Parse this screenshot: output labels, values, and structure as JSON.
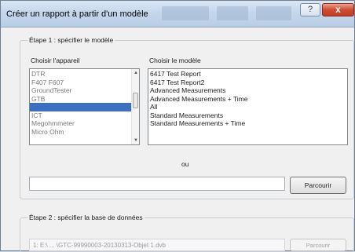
{
  "window": {
    "title": "Créer un rapport à partir d'un modèle",
    "help_label": "?",
    "close_label": "x"
  },
  "step1": {
    "legend": "Étape 1 : spécifier le modèle",
    "device_label": "Choisir l'appareil",
    "model_label": "Choisir le modèle",
    "devices": [
      "DTR",
      "F407 F607",
      "GroundTester",
      "GTB",
      "GTC",
      "ICT",
      "Megohmmeter",
      "Micro Ohm"
    ],
    "selected_device_index": 4,
    "models": [
      "6417 Test Report",
      "6417 Test Report2",
      "Advanced Measurements",
      "Advanced Measurements + Time",
      "All",
      "Standard Measurements",
      "Standard Measurements + Time"
    ],
    "or_label": "ou",
    "file_value": "",
    "browse_label": "Parcourir"
  },
  "step2": {
    "legend": "Étape 2 : spécifier la base de données",
    "path_value": "1: E:\\ ... \\GTC-99990003-20130313-Objet 1.dvb",
    "browse_label": "Parcourir"
  },
  "icons": {
    "help": "help-icon",
    "close": "close-icon",
    "scroll_up": "chevron-up-icon",
    "scroll_down": "chevron-down-icon"
  }
}
